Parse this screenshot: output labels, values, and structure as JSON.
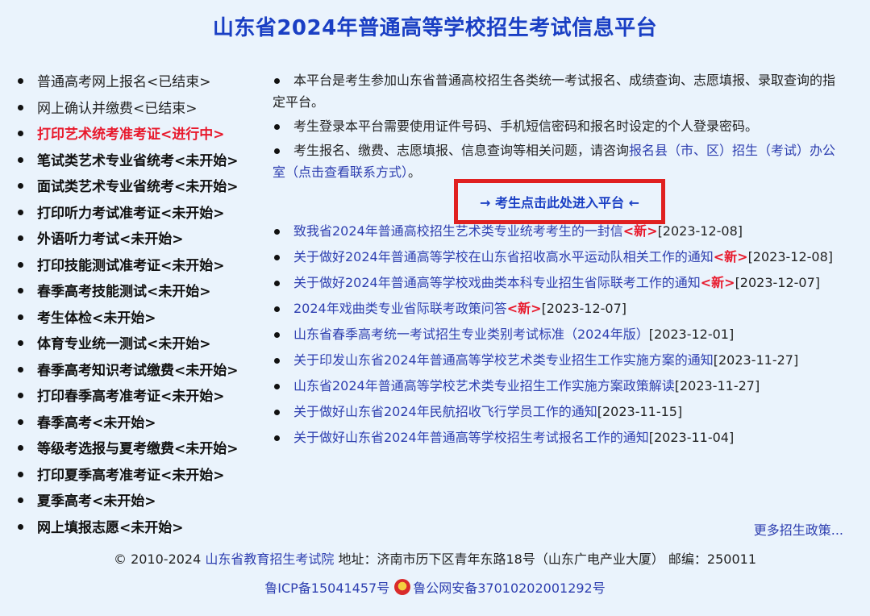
{
  "header": {
    "title": "山东省2024年普通高等学校招生考试信息平台"
  },
  "sidebar": {
    "items": [
      {
        "label": "普通高考网上报名<已结束>",
        "state": "done"
      },
      {
        "label": "网上确认并缴费<已结束>",
        "state": "done"
      },
      {
        "label": "打印艺术统考准考证<进行中>",
        "state": "active"
      },
      {
        "label": "笔试类艺术专业省统考<未开始>",
        "state": "pending"
      },
      {
        "label": "面试类艺术专业省统考<未开始>",
        "state": "pending"
      },
      {
        "label": "打印听力考试准考证<未开始>",
        "state": "pending"
      },
      {
        "label": "外语听力考试<未开始>",
        "state": "pending"
      },
      {
        "label": "打印技能测试准考证<未开始>",
        "state": "pending"
      },
      {
        "label": "春季高考技能测试<未开始>",
        "state": "pending"
      },
      {
        "label": "考生体检<未开始>",
        "state": "pending"
      },
      {
        "label": "体育专业统一测试<未开始>",
        "state": "pending"
      },
      {
        "label": "春季高考知识考试缴费<未开始>",
        "state": "pending"
      },
      {
        "label": "打印春季高考准考证<未开始>",
        "state": "pending"
      },
      {
        "label": "春季高考<未开始>",
        "state": "pending"
      },
      {
        "label": "等级考选报与夏考缴费<未开始>",
        "state": "pending"
      },
      {
        "label": "打印夏季高考准考证<未开始>",
        "state": "pending"
      },
      {
        "label": "夏季高考<未开始>",
        "state": "pending"
      },
      {
        "label": "网上填报志愿<未开始>",
        "state": "pending"
      }
    ]
  },
  "intro": {
    "line1": "本平台是考生参加山东省普通高校招生各类统一考试报名、成绩查询、志愿填报、录取查询的指定平台。",
    "line2": "考生登录本平台需要使用证件号码、手机短信密码和报名时设定的个人登录密码。",
    "line3_text": "考生报名、缴费、志愿填报、信息查询等相关问题，请咨询",
    "line3_link": "报名县（市、区）招生（考试）办公室（点击查看联系方式）",
    "line3_end": "。"
  },
  "enter_button": {
    "label": "→ 考生点击此处进入平台 ←"
  },
  "news": [
    {
      "title": "致我省2024年普通高校招生艺术类专业统考考生的一封信",
      "new": "<新>",
      "date": "[2023-12-08]"
    },
    {
      "title": "关于做好2024年普通高等学校在山东省招收高水平运动队相关工作的通知",
      "new": "<新>",
      "date": "[2023-12-08]"
    },
    {
      "title": "关于做好2024年普通高等学校戏曲类本科专业招生省际联考工作的通知",
      "new": "<新>",
      "date": "[2023-12-07]"
    },
    {
      "title": "2024年戏曲类专业省际联考政策问答",
      "new": "<新>",
      "date": "[2023-12-07]"
    },
    {
      "title": "山东省春季高考统一考试招生专业类别考试标准（2024年版）",
      "new": "",
      "date": "[2023-12-01]"
    },
    {
      "title": "关于印发山东省2024年普通高等学校艺术类专业招生工作实施方案的通知",
      "new": "",
      "date": "[2023-11-27]"
    },
    {
      "title": "山东省2024年普通高等学校艺术类专业招生工作实施方案政策解读",
      "new": "",
      "date": "[2023-11-27]"
    },
    {
      "title": "关于做好山东省2024年民航招收飞行学员工作的通知",
      "new": "",
      "date": "[2023-11-15]"
    },
    {
      "title": "关于做好山东省2024年普通高等学校招生考试报名工作的通知",
      "new": "",
      "date": "[2023-11-04]"
    }
  ],
  "more_link": "更多招生政策...",
  "footer": {
    "copyright": "© 2010-2024 ",
    "org": "山东省教育招生考试院",
    "address": " 地址：济南市历下区青年东路18号（山东广电产业大厦） 邮编：250011",
    "icp": "鲁ICP备15041457号",
    "police": "鲁公网安备37010202001292号"
  },
  "colors": {
    "title": "#1a3fc4",
    "link": "#2e3fb0",
    "active": "#e8192c",
    "highlight_border": "#e02020",
    "background": "#eaf3fc"
  }
}
